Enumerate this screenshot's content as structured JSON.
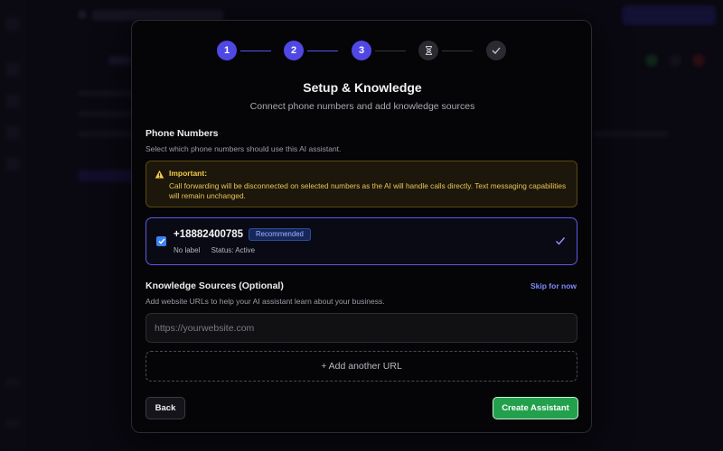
{
  "stepper": {
    "steps": [
      {
        "label": "1",
        "state": "complete"
      },
      {
        "label": "2",
        "state": "complete"
      },
      {
        "label": "3",
        "state": "current"
      },
      {
        "label": "",
        "state": "pending",
        "icon": "hourglass-icon"
      },
      {
        "label": "",
        "state": "pending",
        "icon": "check-icon"
      }
    ]
  },
  "modal": {
    "title": "Setup & Knowledge",
    "subtitle": "Connect phone numbers and add knowledge sources"
  },
  "phone_section": {
    "title": "Phone Numbers",
    "description": "Select which phone numbers should use this AI assistant.",
    "alert": {
      "title": "Important:",
      "text": "Call forwarding will be disconnected on selected numbers as the AI will handle calls directly. Text messaging capabilities will remain unchanged.",
      "icon": "warning-icon",
      "color": "#f2c94c"
    },
    "numbers": [
      {
        "number": "+18882400785",
        "badge": "Recommended",
        "label": "No label",
        "status": "Status: Active",
        "selected": true
      }
    ]
  },
  "knowledge_section": {
    "title": "Knowledge Sources (Optional)",
    "skip_label": "Skip for now",
    "description": "Add website URLs to help your AI assistant learn about your business.",
    "url_placeholder": "https://yourwebsite.com",
    "url_value": "",
    "add_url_label": "+ Add another URL"
  },
  "actions": {
    "back_label": "Back",
    "create_label": "Create Assistant"
  },
  "colors": {
    "accent": "#5048e5",
    "success": "#22a04c",
    "warning": "#f2c94c",
    "link": "#7b8cff"
  }
}
